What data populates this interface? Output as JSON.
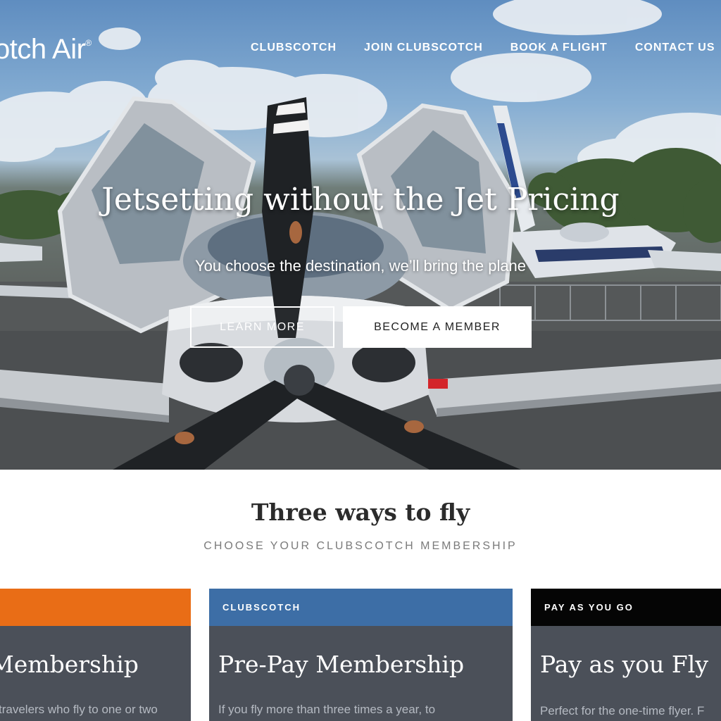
{
  "brand": {
    "logo_text": "otch Air",
    "logo_mark": "®"
  },
  "nav": {
    "items": [
      {
        "label": "CLUBSCOTCH"
      },
      {
        "label": "JOIN CLUBSCOTCH"
      },
      {
        "label": "BOOK A FLIGHT"
      },
      {
        "label": "CONTACT US"
      }
    ]
  },
  "hero": {
    "title": "Jetsetting without the Jet Pricing",
    "subtitle": "You choose the destination, we’ll bring the plane",
    "learn_more": "LEARN MORE",
    "become_member": "BECOME A MEMBER"
  },
  "section": {
    "title": "Three ways to fly",
    "subtitle": "CHOOSE YOUR CLUBSCOTCH MEMBERSHIP"
  },
  "cards": [
    {
      "tag": "",
      "title": "Membership",
      "desc": "travelers who fly to one or two",
      "color": "#e96d16"
    },
    {
      "tag": "CLUBSCOTCH",
      "title": "Pre-Pay Membership",
      "desc": "If you fly more than three times a year, to",
      "color": "#3d6ea6"
    },
    {
      "tag": "PAY AS YOU GO",
      "title": "Pay as you Fly",
      "desc": "Perfect for the one-time flyer. F",
      "color": "#050505"
    }
  ],
  "colors": {
    "card_body": "#4b5059",
    "sky": "#6f98c6",
    "white": "#ffffff"
  }
}
